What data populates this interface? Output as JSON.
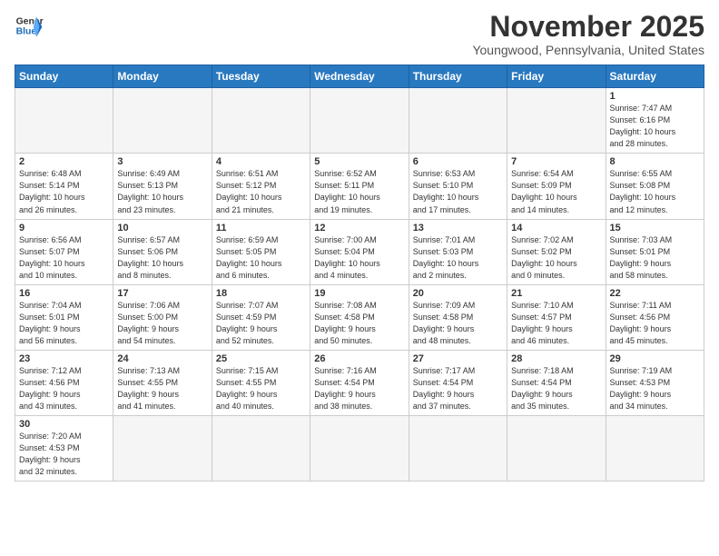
{
  "logo": {
    "general": "General",
    "blue": "Blue"
  },
  "title": "November 2025",
  "subtitle": "Youngwood, Pennsylvania, United States",
  "days_of_week": [
    "Sunday",
    "Monday",
    "Tuesday",
    "Wednesday",
    "Thursday",
    "Friday",
    "Saturday"
  ],
  "weeks": [
    [
      {
        "day": "",
        "info": ""
      },
      {
        "day": "",
        "info": ""
      },
      {
        "day": "",
        "info": ""
      },
      {
        "day": "",
        "info": ""
      },
      {
        "day": "",
        "info": ""
      },
      {
        "day": "",
        "info": ""
      },
      {
        "day": "1",
        "info": "Sunrise: 7:47 AM\nSunset: 6:16 PM\nDaylight: 10 hours\nand 28 minutes."
      }
    ],
    [
      {
        "day": "2",
        "info": "Sunrise: 6:48 AM\nSunset: 5:14 PM\nDaylight: 10 hours\nand 26 minutes."
      },
      {
        "day": "3",
        "info": "Sunrise: 6:49 AM\nSunset: 5:13 PM\nDaylight: 10 hours\nand 23 minutes."
      },
      {
        "day": "4",
        "info": "Sunrise: 6:51 AM\nSunset: 5:12 PM\nDaylight: 10 hours\nand 21 minutes."
      },
      {
        "day": "5",
        "info": "Sunrise: 6:52 AM\nSunset: 5:11 PM\nDaylight: 10 hours\nand 19 minutes."
      },
      {
        "day": "6",
        "info": "Sunrise: 6:53 AM\nSunset: 5:10 PM\nDaylight: 10 hours\nand 17 minutes."
      },
      {
        "day": "7",
        "info": "Sunrise: 6:54 AM\nSunset: 5:09 PM\nDaylight: 10 hours\nand 14 minutes."
      },
      {
        "day": "8",
        "info": "Sunrise: 6:55 AM\nSunset: 5:08 PM\nDaylight: 10 hours\nand 12 minutes."
      }
    ],
    [
      {
        "day": "9",
        "info": "Sunrise: 6:56 AM\nSunset: 5:07 PM\nDaylight: 10 hours\nand 10 minutes."
      },
      {
        "day": "10",
        "info": "Sunrise: 6:57 AM\nSunset: 5:06 PM\nDaylight: 10 hours\nand 8 minutes."
      },
      {
        "day": "11",
        "info": "Sunrise: 6:59 AM\nSunset: 5:05 PM\nDaylight: 10 hours\nand 6 minutes."
      },
      {
        "day": "12",
        "info": "Sunrise: 7:00 AM\nSunset: 5:04 PM\nDaylight: 10 hours\nand 4 minutes."
      },
      {
        "day": "13",
        "info": "Sunrise: 7:01 AM\nSunset: 5:03 PM\nDaylight: 10 hours\nand 2 minutes."
      },
      {
        "day": "14",
        "info": "Sunrise: 7:02 AM\nSunset: 5:02 PM\nDaylight: 10 hours\nand 0 minutes."
      },
      {
        "day": "15",
        "info": "Sunrise: 7:03 AM\nSunset: 5:01 PM\nDaylight: 9 hours\nand 58 minutes."
      }
    ],
    [
      {
        "day": "16",
        "info": "Sunrise: 7:04 AM\nSunset: 5:01 PM\nDaylight: 9 hours\nand 56 minutes."
      },
      {
        "day": "17",
        "info": "Sunrise: 7:06 AM\nSunset: 5:00 PM\nDaylight: 9 hours\nand 54 minutes."
      },
      {
        "day": "18",
        "info": "Sunrise: 7:07 AM\nSunset: 4:59 PM\nDaylight: 9 hours\nand 52 minutes."
      },
      {
        "day": "19",
        "info": "Sunrise: 7:08 AM\nSunset: 4:58 PM\nDaylight: 9 hours\nand 50 minutes."
      },
      {
        "day": "20",
        "info": "Sunrise: 7:09 AM\nSunset: 4:58 PM\nDaylight: 9 hours\nand 48 minutes."
      },
      {
        "day": "21",
        "info": "Sunrise: 7:10 AM\nSunset: 4:57 PM\nDaylight: 9 hours\nand 46 minutes."
      },
      {
        "day": "22",
        "info": "Sunrise: 7:11 AM\nSunset: 4:56 PM\nDaylight: 9 hours\nand 45 minutes."
      }
    ],
    [
      {
        "day": "23",
        "info": "Sunrise: 7:12 AM\nSunset: 4:56 PM\nDaylight: 9 hours\nand 43 minutes."
      },
      {
        "day": "24",
        "info": "Sunrise: 7:13 AM\nSunset: 4:55 PM\nDaylight: 9 hours\nand 41 minutes."
      },
      {
        "day": "25",
        "info": "Sunrise: 7:15 AM\nSunset: 4:55 PM\nDaylight: 9 hours\nand 40 minutes."
      },
      {
        "day": "26",
        "info": "Sunrise: 7:16 AM\nSunset: 4:54 PM\nDaylight: 9 hours\nand 38 minutes."
      },
      {
        "day": "27",
        "info": "Sunrise: 7:17 AM\nSunset: 4:54 PM\nDaylight: 9 hours\nand 37 minutes."
      },
      {
        "day": "28",
        "info": "Sunrise: 7:18 AM\nSunset: 4:54 PM\nDaylight: 9 hours\nand 35 minutes."
      },
      {
        "day": "29",
        "info": "Sunrise: 7:19 AM\nSunset: 4:53 PM\nDaylight: 9 hours\nand 34 minutes."
      }
    ],
    [
      {
        "day": "30",
        "info": "Sunrise: 7:20 AM\nSunset: 4:53 PM\nDaylight: 9 hours\nand 32 minutes."
      },
      {
        "day": "",
        "info": ""
      },
      {
        "day": "",
        "info": ""
      },
      {
        "day": "",
        "info": ""
      },
      {
        "day": "",
        "info": ""
      },
      {
        "day": "",
        "info": ""
      },
      {
        "day": "",
        "info": ""
      }
    ]
  ]
}
